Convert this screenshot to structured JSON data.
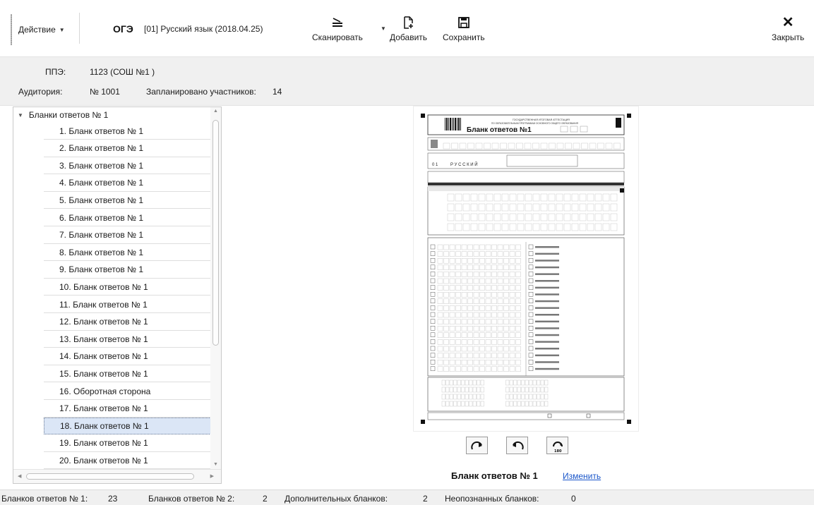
{
  "toolbar": {
    "action_label": "Действие",
    "exam_code": "ОГЭ",
    "exam_name": "[01] Русский язык (2018.04.25)",
    "scan_label": "Сканировать",
    "add_label": "Добавить",
    "save_label": "Сохранить",
    "close_label": "Закрыть"
  },
  "info": {
    "ppe_label": "ППЭ:",
    "ppe_value": "1123 (СОШ №1 )",
    "auditorium_label": "Аудитория:",
    "auditorium_value": "№ 1001",
    "planned_label": "Запланировано участников:",
    "planned_value": "14"
  },
  "tree": {
    "root_label": "Бланки ответов № 1",
    "items": [
      "1. Бланк ответов № 1",
      "2. Бланк ответов № 1",
      "3. Бланк ответов № 1",
      "4. Бланк ответов № 1",
      "5. Бланк ответов № 1",
      "6. Бланк ответов № 1",
      "7. Бланк ответов № 1",
      "8. Бланк ответов № 1",
      "9. Бланк ответов № 1",
      "10. Бланк ответов № 1",
      "11. Бланк ответов № 1",
      "12. Бланк ответов № 1",
      "13. Бланк ответов № 1",
      "14. Бланк ответов № 1",
      "15. Бланк ответов № 1",
      "16. Оборотная сторона",
      "17. Бланк ответов № 1",
      "18. Бланк ответов № 1",
      "19. Бланк ответов № 1",
      "20. Бланк ответов № 1"
    ],
    "selected_index": 17
  },
  "preview": {
    "form_title": "Бланк ответов №1",
    "form_subject": "Р У С С К И Й",
    "form_code": "0 1"
  },
  "blank": {
    "label": "Бланк ответов № 1",
    "change_link": "Изменить"
  },
  "status": {
    "b1_label": "Бланков ответов № 1:",
    "b1_value": "23",
    "b2_label": "Бланков ответов № 2:",
    "b2_value": "2",
    "extra_label": "Дополнительных бланков:",
    "extra_value": "2",
    "unknown_label": "Неопознанных бланков:",
    "unknown_value": "0"
  },
  "icons": {
    "scan": "scanner-icon",
    "add": "add-document-icon",
    "save": "floppy-disk-icon",
    "close": "close-icon",
    "rotate_cw": "rotate-clockwise-icon",
    "rotate_ccw": "rotate-counterclockwise-icon",
    "rotate_180": "rotate-180-icon"
  }
}
